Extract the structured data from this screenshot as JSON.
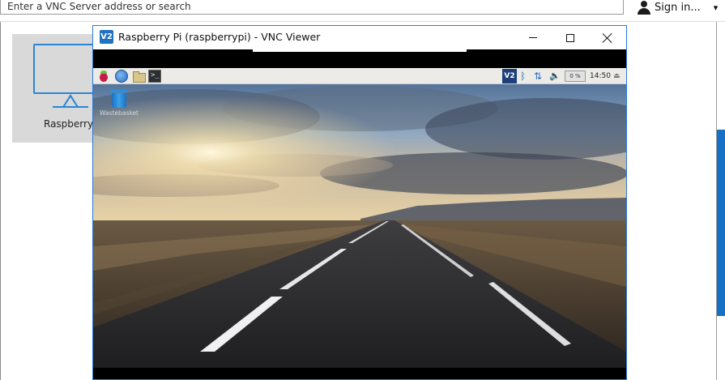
{
  "address_book": {
    "search_placeholder": "Enter a VNC Server address or search",
    "sign_in_label": "Sign in...",
    "sign_in_caret": "▾",
    "computer_tile_label": "Raspberry Pi",
    "accent_color": "#2b86d6"
  },
  "vnc_viewer": {
    "title": "Raspberry Pi (raspberrypi) - VNC Viewer",
    "logo_text": "V2",
    "controls": {
      "minimize": "minimize",
      "maximize": "maximize",
      "close": "close"
    },
    "remote_desktop": {
      "panel": {
        "launcher_icons": [
          "raspberry-menu-icon",
          "web-browser-icon",
          "file-manager-icon",
          "terminal-icon"
        ],
        "terminal_glyph": ">_",
        "vnc_tray_text": "V2",
        "bluetooth_glyph": "ᛒ",
        "network_glyph": "⇅",
        "volume_glyph": "🔈",
        "cpu_text": "0 %",
        "clock": "14:50",
        "eject_glyph": "⏏"
      },
      "desktop_icon_label": "Wastebasket",
      "wallpaper": "open road at sunset under a cloudy sky"
    }
  }
}
